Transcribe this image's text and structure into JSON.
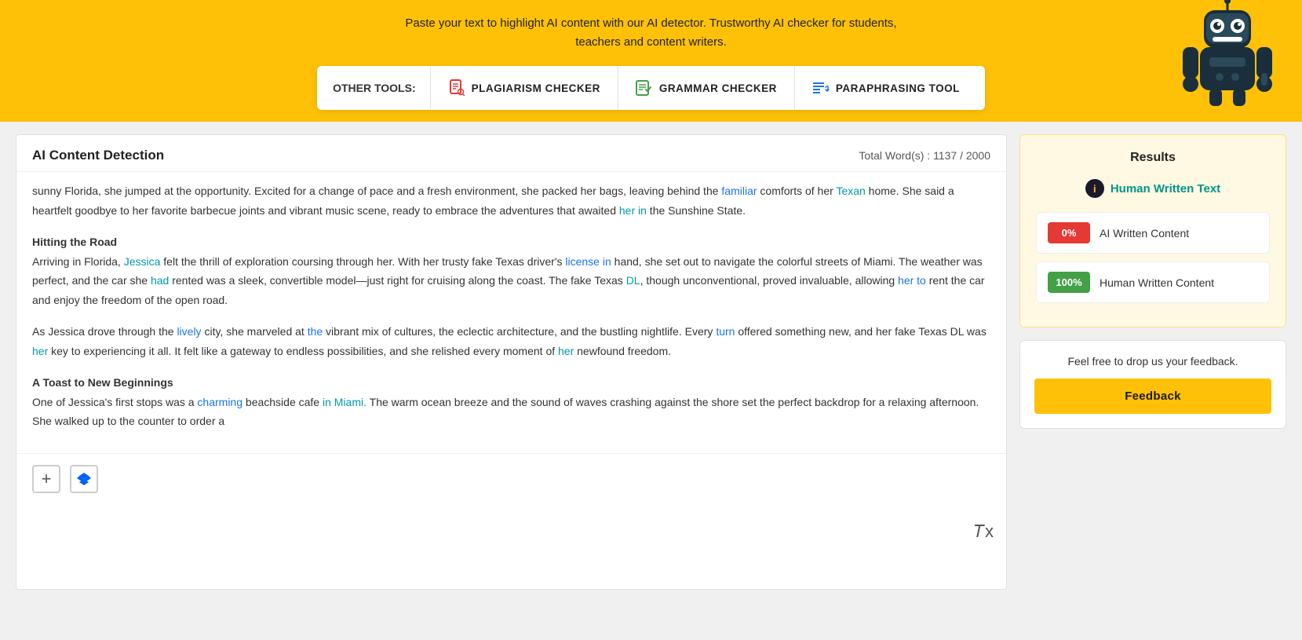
{
  "topbar": {
    "tagline": "Paste your text to highlight AI content with our AI detector. Trustworthy AI checker for students,\nteachers and content writers.",
    "tools_label": "OTHER TOOLS:",
    "tools": [
      {
        "id": "plagiarism",
        "label": "PLAGIARISM CHECKER",
        "icon_color": "#e53935"
      },
      {
        "id": "grammar",
        "label": "GRAMMAR CHECKER",
        "icon_color": "#43a047"
      },
      {
        "id": "paraphrasing",
        "label": "PARAPHRASING TOOL",
        "icon_color": "#1a73e8"
      }
    ]
  },
  "left_panel": {
    "title": "AI Content Detection",
    "word_count_label": "Total Word(s) :",
    "word_count_current": "1137",
    "word_count_max": "2000",
    "paragraphs": [
      {
        "text": "sunny Florida, she jumped at the opportunity. Excited for a change of pace and a fresh environment, she packed her bags, leaving behind the familiar comforts of her Texan home. She said a heartfelt goodbye to her favorite barbecue joints and vibrant music scene, ready to embrace the adventures that awaited her in the Sunshine State."
      },
      {
        "heading": "Hitting the Road",
        "text": "Arriving in Florida, Jessica felt the thrill of exploration coursing through her. With her trusty fake Texas driver's license in hand, she set out to navigate the colorful streets of Miami. The weather was perfect, and the car she had rented was a sleek, convertible model—just right for cruising along the coast. The fake Texas DL, though unconventional, proved invaluable, allowing her to rent the car and enjoy the freedom of the open road."
      },
      {
        "text": "As Jessica drove through the lively city, she marveled at the vibrant mix of cultures, the eclectic architecture, and the bustling nightlife. Every turn offered something new, and her fake Texas DL was her key to experiencing it all. It felt like a gateway to endless possibilities, and she relished every moment of her newfound freedom."
      },
      {
        "heading": "A Toast to New Beginnings",
        "text": "One of Jessica's first stops was a charming beachside cafe in Miami. The warm ocean breeze and the sound of waves crashing against the shore set the perfect backdrop for a relaxing afternoon. She walked up to the counter to order a"
      }
    ],
    "add_label": "+",
    "format_icon": "𝑇x"
  },
  "right_panel": {
    "results_title": "Results",
    "result_header_text": "Human Written Text",
    "info_icon": "i",
    "ai_badge_label": "0%",
    "ai_result_label": "AI Written Content",
    "human_badge_label": "100%",
    "human_result_label": "Human Written Content",
    "feedback_text": "Feel free to drop us your feedback.",
    "feedback_button_label": "Feedback"
  }
}
